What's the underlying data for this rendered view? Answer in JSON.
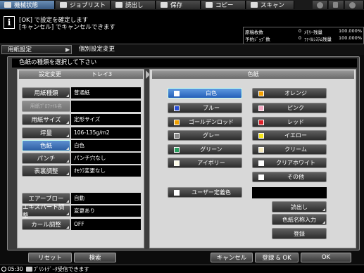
{
  "tabs": [
    {
      "label": "機械状態",
      "icon": "machine-status-icon",
      "active": true
    },
    {
      "label": "ジョブリスト",
      "icon": "job-list-icon",
      "active": false
    },
    {
      "label": "読出し",
      "icon": "recall-icon",
      "active": false
    },
    {
      "label": "保存",
      "icon": "save-icon",
      "active": false
    },
    {
      "label": "コピー",
      "icon": "copy-icon",
      "active": false
    },
    {
      "label": "スキャン",
      "icon": "scan-icon",
      "active": false
    }
  ],
  "message": {
    "line1": "[OK] で設定を確定します",
    "line2": "[キャンセル] でキャンセルできます"
  },
  "counters": {
    "row1": {
      "label": "原稿枚数",
      "value": "0",
      "label2": "ﾒﾓﾘｰ残量",
      "value2": "100.000%"
    },
    "row2": {
      "label": "予約ｼﾞｮﾌﾞ数",
      "value": "0",
      "label2": "ﾌｧｲﾙｼｽﾃﾑ残量",
      "value2": "100.000%"
    }
  },
  "breadcrumb": {
    "parent": "用紙設定",
    "current": "個別設定変更"
  },
  "prompt": "色紙の種類を選択して下さい",
  "left": {
    "header_left": "設定変更",
    "header_right": "トレイ3",
    "settings": [
      {
        "label": "用紙種類",
        "value": "普通紙"
      },
      {
        "label": "用紙ﾌﾟﾛﾌｧｲﾙ名",
        "value": "",
        "disabled": true
      },
      {
        "label": "用紙サイズ",
        "value": "定形サイズ"
      },
      {
        "label": "坪量",
        "value": "106-135g/m2"
      },
      {
        "label": "色紙",
        "value": "白色",
        "selected": true
      },
      {
        "label": "パンチ",
        "value": "パンチ穴なし"
      },
      {
        "label": "表裏調整",
        "value": "ｵﾓｳﾗ変更なし"
      }
    ],
    "settings2": [
      {
        "label": "エアーブロー",
        "value": "自動"
      },
      {
        "label": "エキスパート調整",
        "value": "変更あり"
      },
      {
        "label": "カール調整",
        "value": "OFF"
      }
    ]
  },
  "right": {
    "header": "色紙",
    "colors": [
      {
        "label": "白色",
        "swatch": "#ffffff",
        "selected": true
      },
      {
        "label": "オレンジ",
        "swatch": "#f5a000"
      },
      {
        "label": "ブルー",
        "swatch": "#2a4fd6"
      },
      {
        "label": "ピンク",
        "swatch": "#f6a9c4"
      },
      {
        "label": "ゴールデンロッド",
        "swatch": "#f0a000"
      },
      {
        "label": "レッド",
        "swatch": "#e0212a"
      },
      {
        "label": "グレー",
        "swatch": "#8a8a8a"
      },
      {
        "label": "イエロー",
        "swatch": "#f7e61a"
      },
      {
        "label": "グリーン",
        "swatch": "#2aa060"
      },
      {
        "label": "クリーム",
        "swatch": "#f6ebbe"
      },
      {
        "label": "アイボリー",
        "swatch": "#fdfbe8"
      },
      {
        "label": "クリアホワイト",
        "swatch": "#ffffff"
      },
      {
        "label": "その他",
        "swatch": "#ffffff"
      }
    ],
    "user_defined": {
      "label": "ユーザー定義色",
      "swatch": "#ffffff",
      "value": ""
    },
    "recall_label": "読出し",
    "color_name_label": "色紙名称入力",
    "register_label": "登録"
  },
  "bottom": {
    "reset": "リセット",
    "search": "検索",
    "cancel": "キャンセル",
    "register_ok": "登録 & OK",
    "ok": "OK"
  },
  "status": {
    "time": "05:30",
    "text": "ﾌﾟﾘﾝﾄﾃﾞｰﾀ受信できます"
  }
}
